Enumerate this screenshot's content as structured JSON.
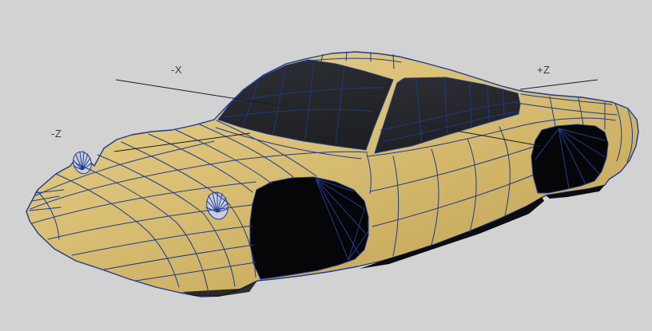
{
  "viewport": {
    "description": "3D modeling viewport with wireframe-shaded polygonal car mesh",
    "axis_labels": {
      "neg_x": "-X",
      "pos_z": "+Z",
      "neg_z": "-Z"
    },
    "colors": {
      "background": "#d2d2d2",
      "body": "#d9bf74",
      "body_highlight": "#e9d18c",
      "body_shadow": "#c1a254",
      "wireframe": "#1d3b90",
      "glass": "#1f2024",
      "glass_highlight": "#2e2f34",
      "wheel_well": "#060608",
      "rocker": "#0b0c0f",
      "headlight": "#c9cdde",
      "axis_line": "#1c1c1c",
      "label_text": "#3c3c3c"
    }
  }
}
